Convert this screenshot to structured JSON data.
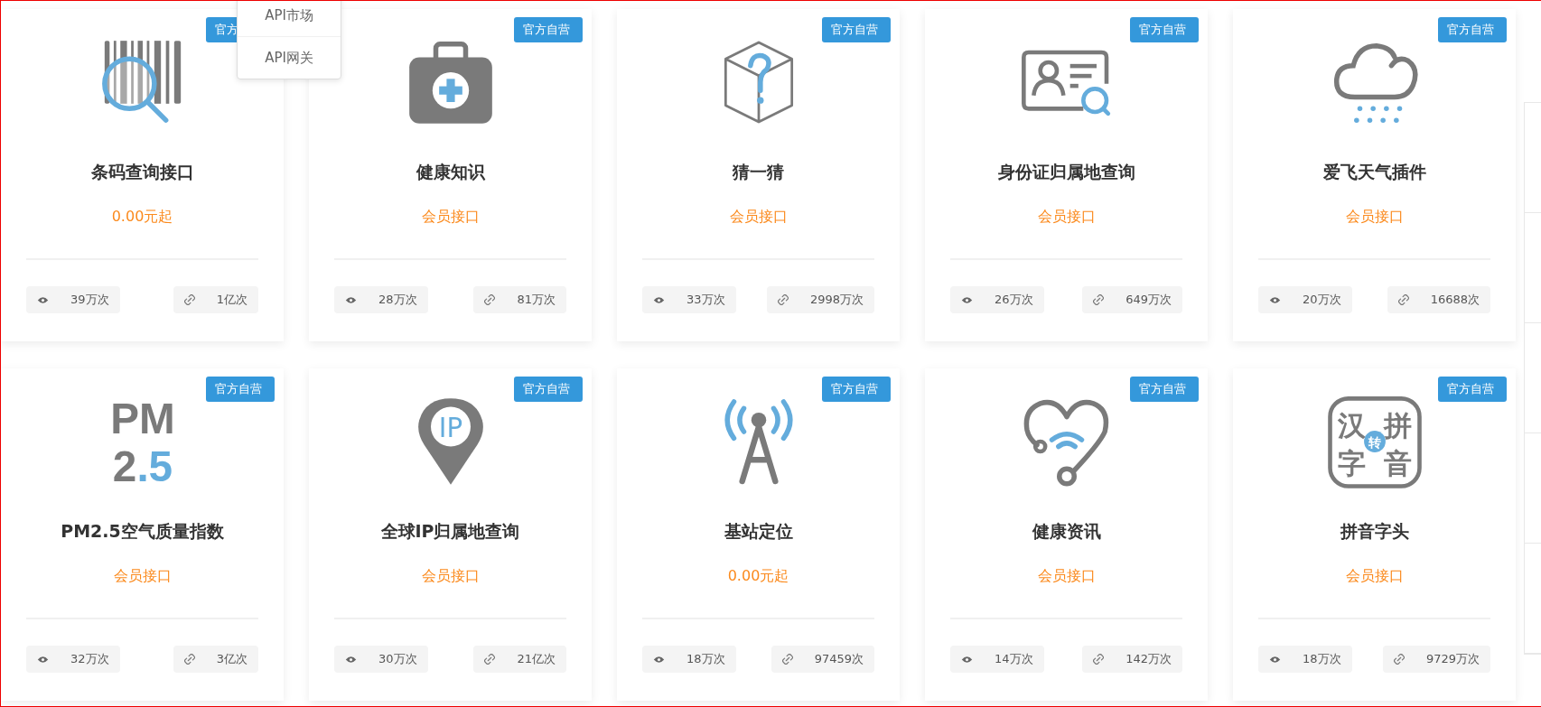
{
  "dropdown": {
    "items": [
      {
        "label": "API市场"
      },
      {
        "label": "API网关"
      }
    ]
  },
  "cards": [
    {
      "icon": {
        "kind": "barcode"
      },
      "badge": "官方",
      "title": "条码查询接口",
      "price": "0.00元起",
      "views": "39万次",
      "calls": "1亿次"
    },
    {
      "icon": {
        "kind": "medkit"
      },
      "badge": "官方自营",
      "title": "健康知识",
      "price": "会员接口",
      "views": "28万次",
      "calls": "81万次"
    },
    {
      "icon": {
        "kind": "cube"
      },
      "badge": "官方自营",
      "title": "猜一猜",
      "price": "会员接口",
      "views": "33万次",
      "calls": "2998万次"
    },
    {
      "icon": {
        "kind": "idcard"
      },
      "badge": "官方自营",
      "title": "身份证归属地查询",
      "price": "会员接口",
      "views": "26万次",
      "calls": "649万次"
    },
    {
      "icon": {
        "kind": "cloud"
      },
      "badge": "官方自营",
      "title": "爱飞天气插件",
      "price": "会员接口",
      "views": "20万次",
      "calls": "16688次"
    },
    {
      "icon": {
        "kind": "pm",
        "texts": [
          "PM",
          "2.5"
        ]
      },
      "badge": "官方自营",
      "title": "PM2.5空气质量指数",
      "price": "会员接口",
      "views": "32万次",
      "calls": "3亿次"
    },
    {
      "icon": {
        "kind": "pin",
        "texts": [
          "IP"
        ]
      },
      "badge": "官方自营",
      "title": "全球IP归属地查询",
      "price": "会员接口",
      "views": "30万次",
      "calls": "21亿次"
    },
    {
      "icon": {
        "kind": "tower"
      },
      "badge": "官方自营",
      "title": "基站定位",
      "price": "0.00元起",
      "views": "18万次",
      "calls": "97459次"
    },
    {
      "icon": {
        "kind": "heart"
      },
      "badge": "官方自营",
      "title": "健康资讯",
      "price": "会员接口",
      "views": "14万次",
      "calls": "142万次"
    },
    {
      "icon": {
        "kind": "pinyin",
        "texts": [
          "汉",
          "拼",
          "字",
          "音",
          "转"
        ]
      },
      "badge": "官方自营",
      "title": "拼音字头",
      "price": "会员接口",
      "views": "18万次",
      "calls": "9729万次"
    }
  ]
}
